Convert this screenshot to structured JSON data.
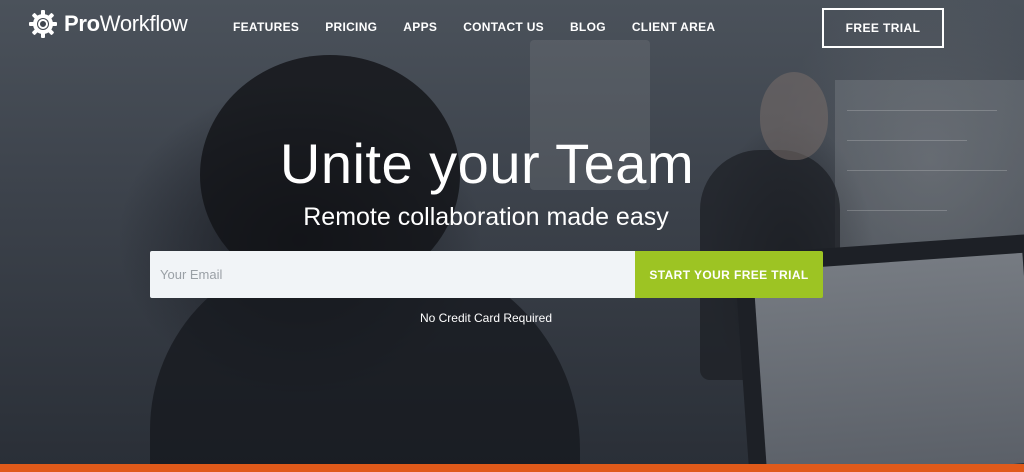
{
  "brand": {
    "logo_bold": "Pro",
    "logo_light": "Workflow",
    "logo_icon": "gear-icon"
  },
  "nav": {
    "items": [
      {
        "label": "FEATURES"
      },
      {
        "label": "PRICING"
      },
      {
        "label": "APPS"
      },
      {
        "label": "CONTACT US"
      },
      {
        "label": "BLOG"
      },
      {
        "label": "CLIENT AREA"
      }
    ],
    "trial_label": "FREE TRIAL"
  },
  "hero": {
    "title": "Unite your Team",
    "subtitle": "Remote collaboration made easy",
    "email_placeholder": "Your Email",
    "email_value": "",
    "cta_label": "START YOUR FREE TRIAL",
    "note": "No Credit Card Required"
  },
  "colors": {
    "accent_green": "#9dc423",
    "strip_orange": "#e05a1a",
    "text": "#ffffff"
  }
}
